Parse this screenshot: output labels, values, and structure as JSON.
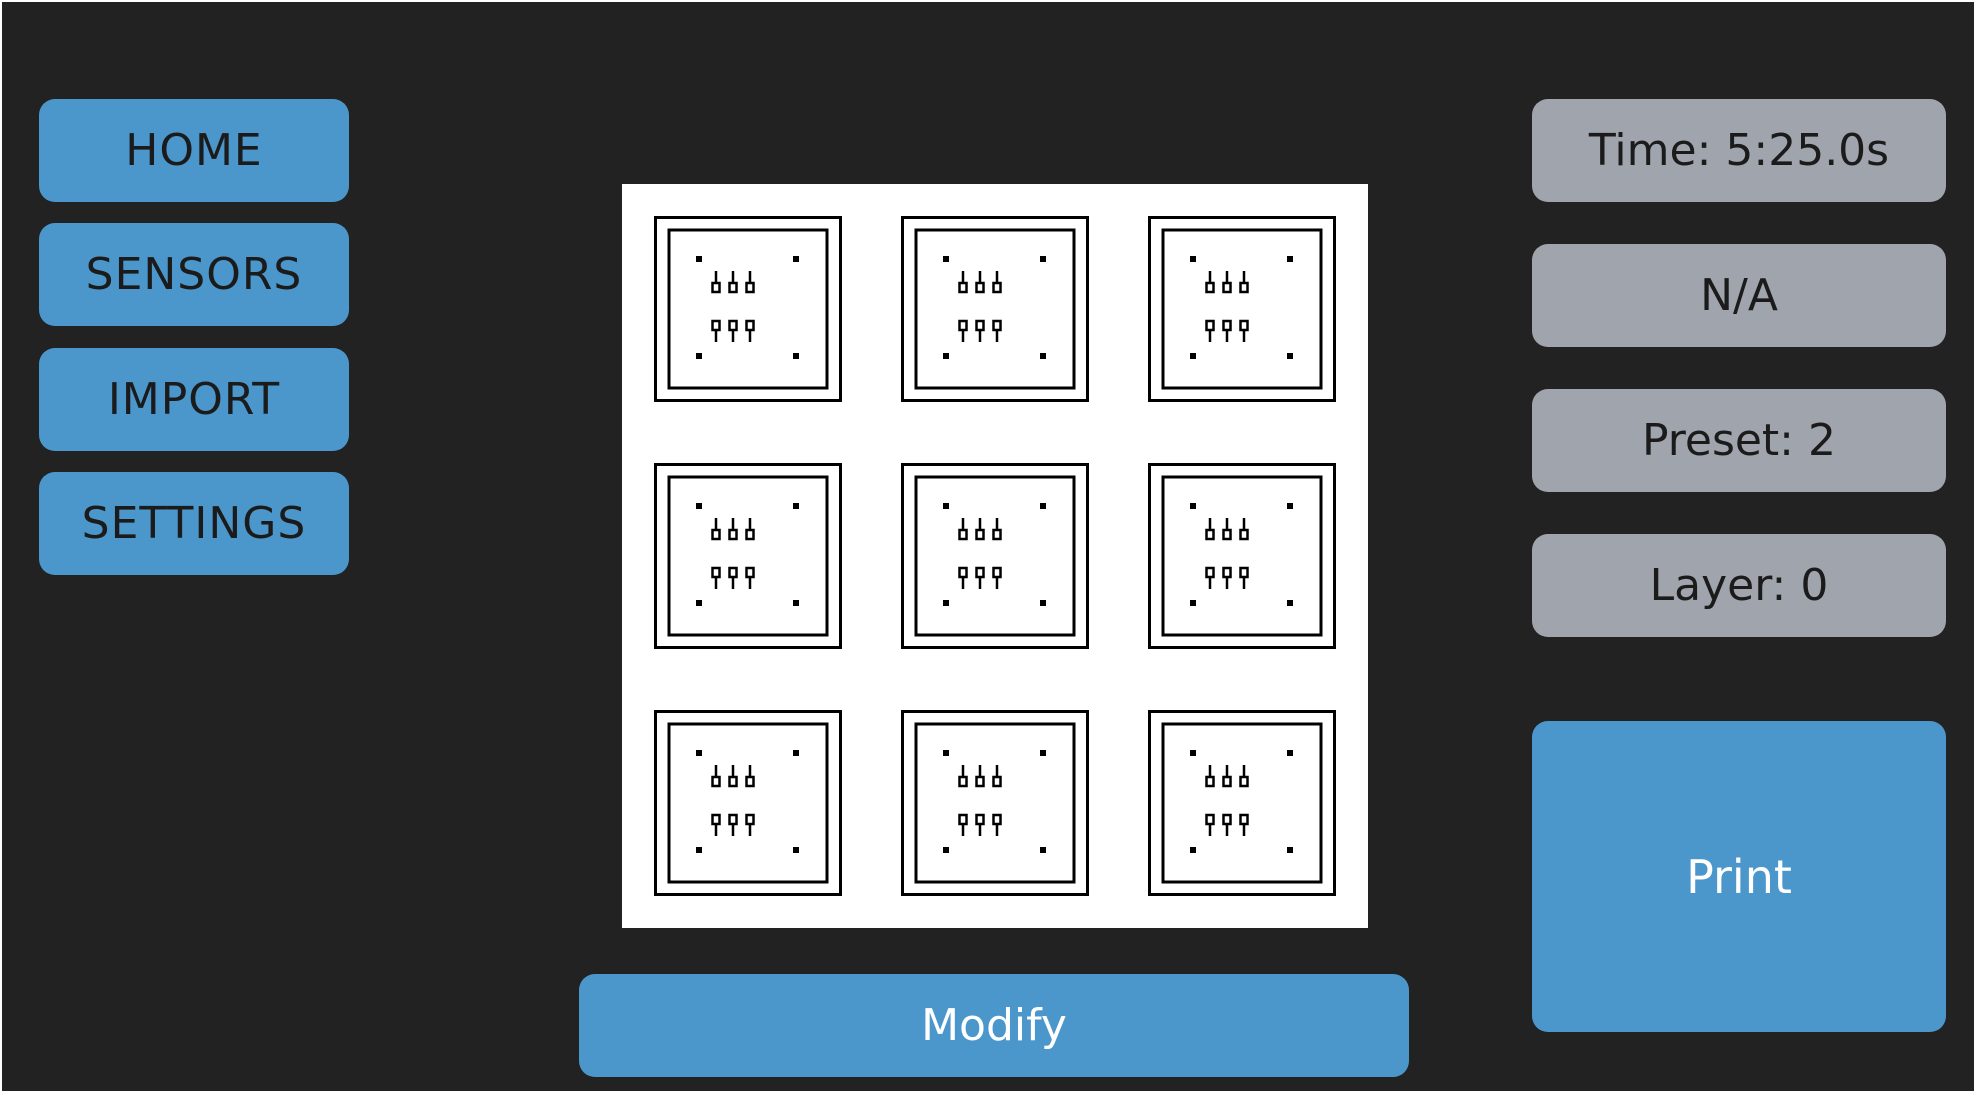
{
  "nav": {
    "home": "HOME",
    "sensors": "SENSORS",
    "import": "IMPORT",
    "settings": "SETTINGS"
  },
  "status": {
    "time": "Time: 5:25.0s",
    "file": "N/A",
    "preset": "Preset: 2",
    "layer": "Layer: 0"
  },
  "actions": {
    "print": "Print",
    "modify": "Modify"
  },
  "preview": {
    "rows": 3,
    "cols": 3,
    "icon": "component-footprint-icon"
  },
  "colors": {
    "background": "#222222",
    "accent": "#4b97cc",
    "info": "#a0a4ad"
  }
}
